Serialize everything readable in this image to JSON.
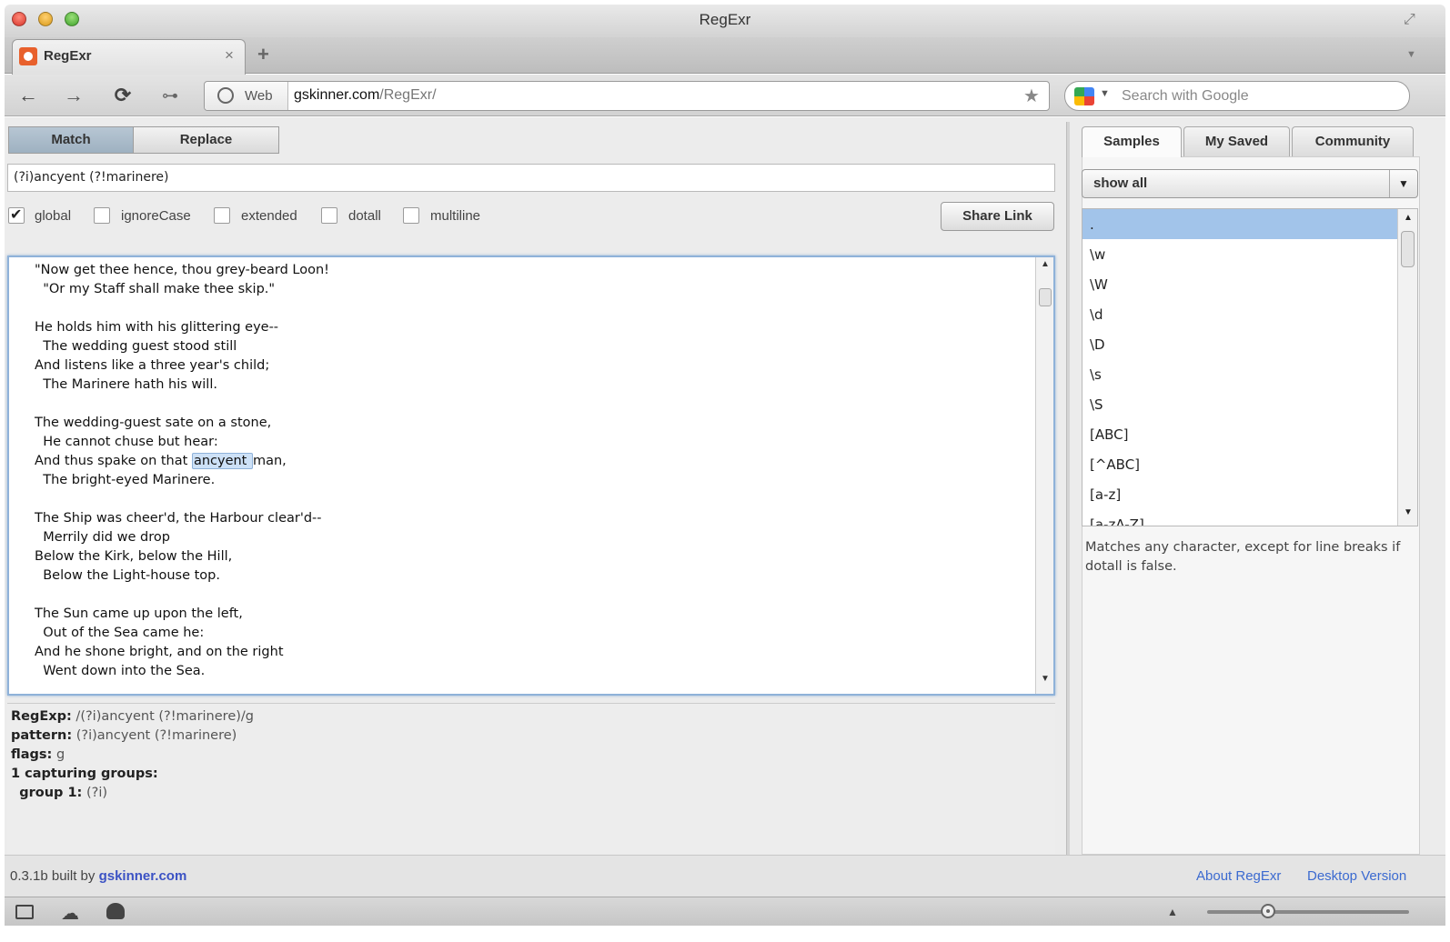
{
  "window": {
    "title": "RegExr"
  },
  "browser": {
    "tab_title": "RegExr",
    "tab_close": "×",
    "new_tab": "+",
    "tab_menu": "▼",
    "back": "←",
    "forward": "→",
    "reload": "⟳",
    "key": "⊶",
    "web_label": "Web",
    "url_domain": "gskinner.com",
    "url_path": "/RegExr/",
    "bookmark": "★",
    "search_dropdown": "▼",
    "search_placeholder": "Search with Google",
    "fullscreen": "⤢"
  },
  "app": {
    "mode_tabs": {
      "match": "Match",
      "replace": "Replace"
    },
    "regex_input": "(?i)ancyent (?!marinere)",
    "flags": [
      {
        "name": "global",
        "checked": true
      },
      {
        "name": "ignoreCase",
        "checked": false
      },
      {
        "name": "extended",
        "checked": false
      },
      {
        "name": "dotall",
        "checked": false
      },
      {
        "name": "multiline",
        "checked": false
      }
    ],
    "share_link": "Share Link",
    "text_lines": [
      "\"Now get thee hence, thou grey-beard Loon!",
      "  \"Or my Staff shall make thee skip.\"",
      "",
      "He holds him with his glittering eye--",
      "  The wedding guest stood still",
      "And listens like a three year's child;",
      "  The Marinere hath his will.",
      "",
      "The wedding-guest sate on a stone,",
      "  He cannot chuse but hear:",
      "And thus spake on that ",
      "  The bright-eyed Marinere.",
      "",
      "The Ship was cheer'd, the Harbour clear'd--",
      "  Merrily did we drop",
      "Below the Kirk, below the Hill,",
      "  Below the Light-house top.",
      "",
      "The Sun came up upon the left,",
      "  Out of the Sea came he:",
      "And he shone bright, and on the right",
      "  Went down into the Sea."
    ],
    "match_text": "ancyent ",
    "match_after": "man,",
    "details": {
      "regexp_label": "RegExp:",
      "regexp_value": " /(?i)ancyent (?!marinere)/g",
      "pattern_label": "pattern:",
      "pattern_value": " (?i)ancyent (?!marinere)",
      "flags_label": "flags:",
      "flags_value": " g",
      "groups_label": "1 capturing groups:",
      "group1_label": "group 1:",
      "group1_value": " (?i)"
    },
    "side_tabs": {
      "samples": "Samples",
      "my_saved": "My Saved",
      "community": "Community"
    },
    "filter_value": "show all",
    "filter_arrow": "▼",
    "samples": [
      ".",
      "\\w",
      "\\W",
      "\\d",
      "\\D",
      "\\s",
      "\\S",
      "[ABC]",
      "[^ABC]",
      "[a-z]",
      "[a-zA-Z]"
    ],
    "sample_description": "Matches any character, except for line breaks if dotall is false.",
    "scroll_up": "▲",
    "scroll_down": "▼"
  },
  "footer": {
    "version": "0.3.1b built by ",
    "version_link": "gskinner.com",
    "about": "About RegExr",
    "desktop": "Desktop Version"
  },
  "statusbar": {
    "cloud": "☁",
    "up": "▲",
    "zoom_level": 0.3
  }
}
